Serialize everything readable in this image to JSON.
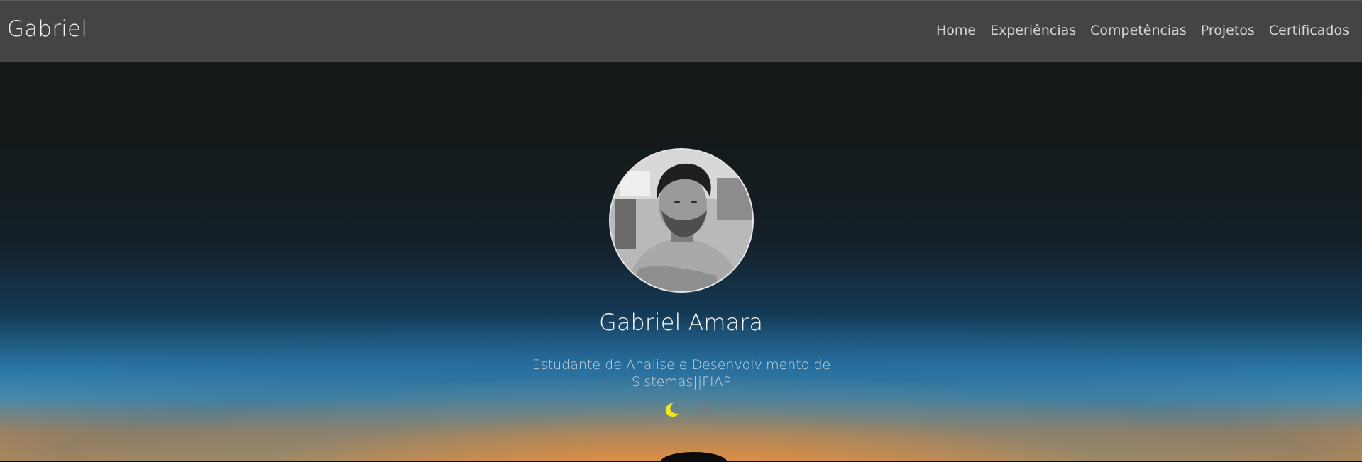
{
  "navbar": {
    "brand": "Gabriel",
    "links": [
      {
        "label": "Home"
      },
      {
        "label": "Experiências"
      },
      {
        "label": "Competências"
      },
      {
        "label": "Projetos"
      },
      {
        "label": "Certificados"
      }
    ]
  },
  "profile": {
    "name": "Gabriel Amara",
    "subtitle": "Estudante de Analise e Desenvolvimento de Sistemas||FIAP",
    "avatar_icon": "profile-photo"
  },
  "theme_toggle": {
    "dark_icon": "moon-icon",
    "light_icon": "sun-icon",
    "colors": {
      "moon": "#f2e61c",
      "sun": "#7a7a7a"
    }
  },
  "colors": {
    "navbar_bg": "#434543",
    "nav_text": "#d4d4d4",
    "brand_text": "#f2f2f2",
    "sunset_glow": "#e59a46",
    "sky_blue": "#2a78a8"
  }
}
